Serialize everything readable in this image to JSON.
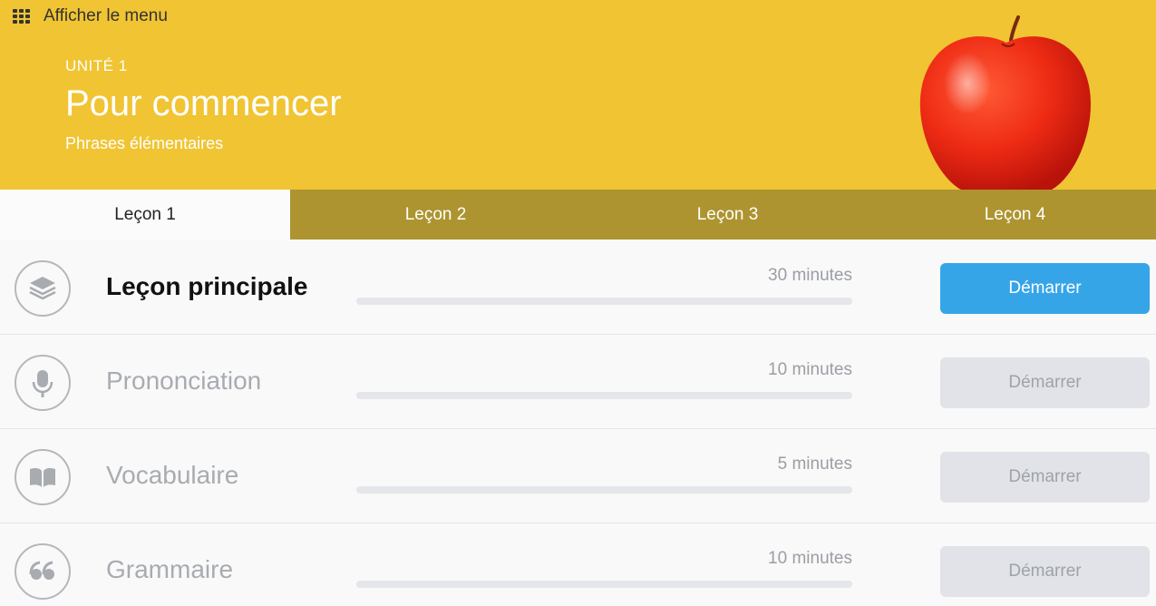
{
  "header": {
    "menu_label": "Afficher le menu",
    "unit_label": "UNITÉ 1",
    "unit_title": "Pour commencer",
    "unit_subtitle": "Phrases élémentaires"
  },
  "tabs": [
    {
      "label": "Leçon 1",
      "active": true
    },
    {
      "label": "Leçon 2",
      "active": false
    },
    {
      "label": "Leçon 3",
      "active": false
    },
    {
      "label": "Leçon 4",
      "active": false
    }
  ],
  "rows": [
    {
      "title": "Leçon principale",
      "duration": "30 minutes",
      "button": "Démarrer",
      "icon": "layers-icon",
      "progress": 0,
      "enabled": true
    },
    {
      "title": "Prononciation",
      "duration": "10 minutes",
      "button": "Démarrer",
      "icon": "microphone-icon",
      "progress": 0,
      "enabled": false
    },
    {
      "title": "Vocabulaire",
      "duration": "5 minutes",
      "button": "Démarrer",
      "icon": "book-icon",
      "progress": 0,
      "enabled": false
    },
    {
      "title": "Grammaire",
      "duration": "10 minutes",
      "button": "Démarrer",
      "icon": "quote-icon",
      "progress": 0,
      "enabled": false
    }
  ],
  "colors": {
    "header_bg": "#f0c433",
    "tab_bar_bg": "#ad9430",
    "primary_button": "#35a5e8",
    "disabled_button": "#e1e3e8"
  }
}
